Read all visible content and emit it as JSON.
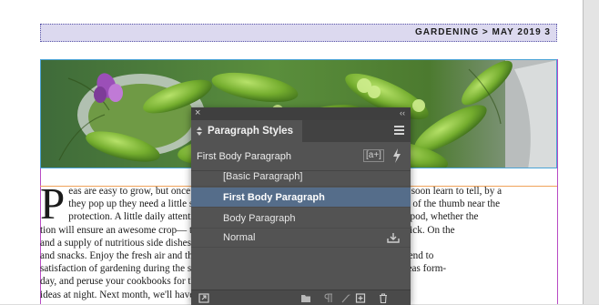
{
  "header": {
    "running_head": "GARDENING  >  MAY 2019    3"
  },
  "article": {
    "drop_cap": "P",
    "lines": [
      "eas are easy to grow, but once they are grown the picking of them is an art. You can soon learn to tell, by a",
      "they pop up they need a little support, just a slight squeeze, and by a gentle pressure of the thumb near the",
      "protection. A little daily attention, and the peas are ready when the upper end of the pod, whether the",
      "tion will ensure an awesome crop— the pod is filled out and the peas are large enough to pick. On the",
      "and a supply of nutritious side dishes. On the other hand, it is unwise to leave them",
      "and snacks. Enjoy the fresh air and the sunshine as you leave the vines to dry, as that will tend to",
      "satisfaction of gardening during the summer months, which will check the growth of the peas form-",
      "day, and peruse your cookbooks for the top of the vine. In taking",
      "ideas at night. Next month, we'll have the pod from the vines, be careful to"
    ]
  },
  "panel": {
    "title": "Paragraph Styles",
    "current_style": "First Body Paragraph",
    "new_from_selection_label": "[a+]",
    "styles": [
      {
        "label": "[Basic Paragraph]",
        "selected": false
      },
      {
        "label": "First Body Paragraph",
        "selected": true
      },
      {
        "label": "Body Paragraph",
        "selected": false
      },
      {
        "label": "Normal",
        "selected": false
      }
    ]
  },
  "colors": {
    "panel_bg": "#535353",
    "selection": "#556d8a",
    "margin_guide": "#b84bc4",
    "frame_edge": "#4aa3d6",
    "header_fill": "#dcd9ef"
  }
}
